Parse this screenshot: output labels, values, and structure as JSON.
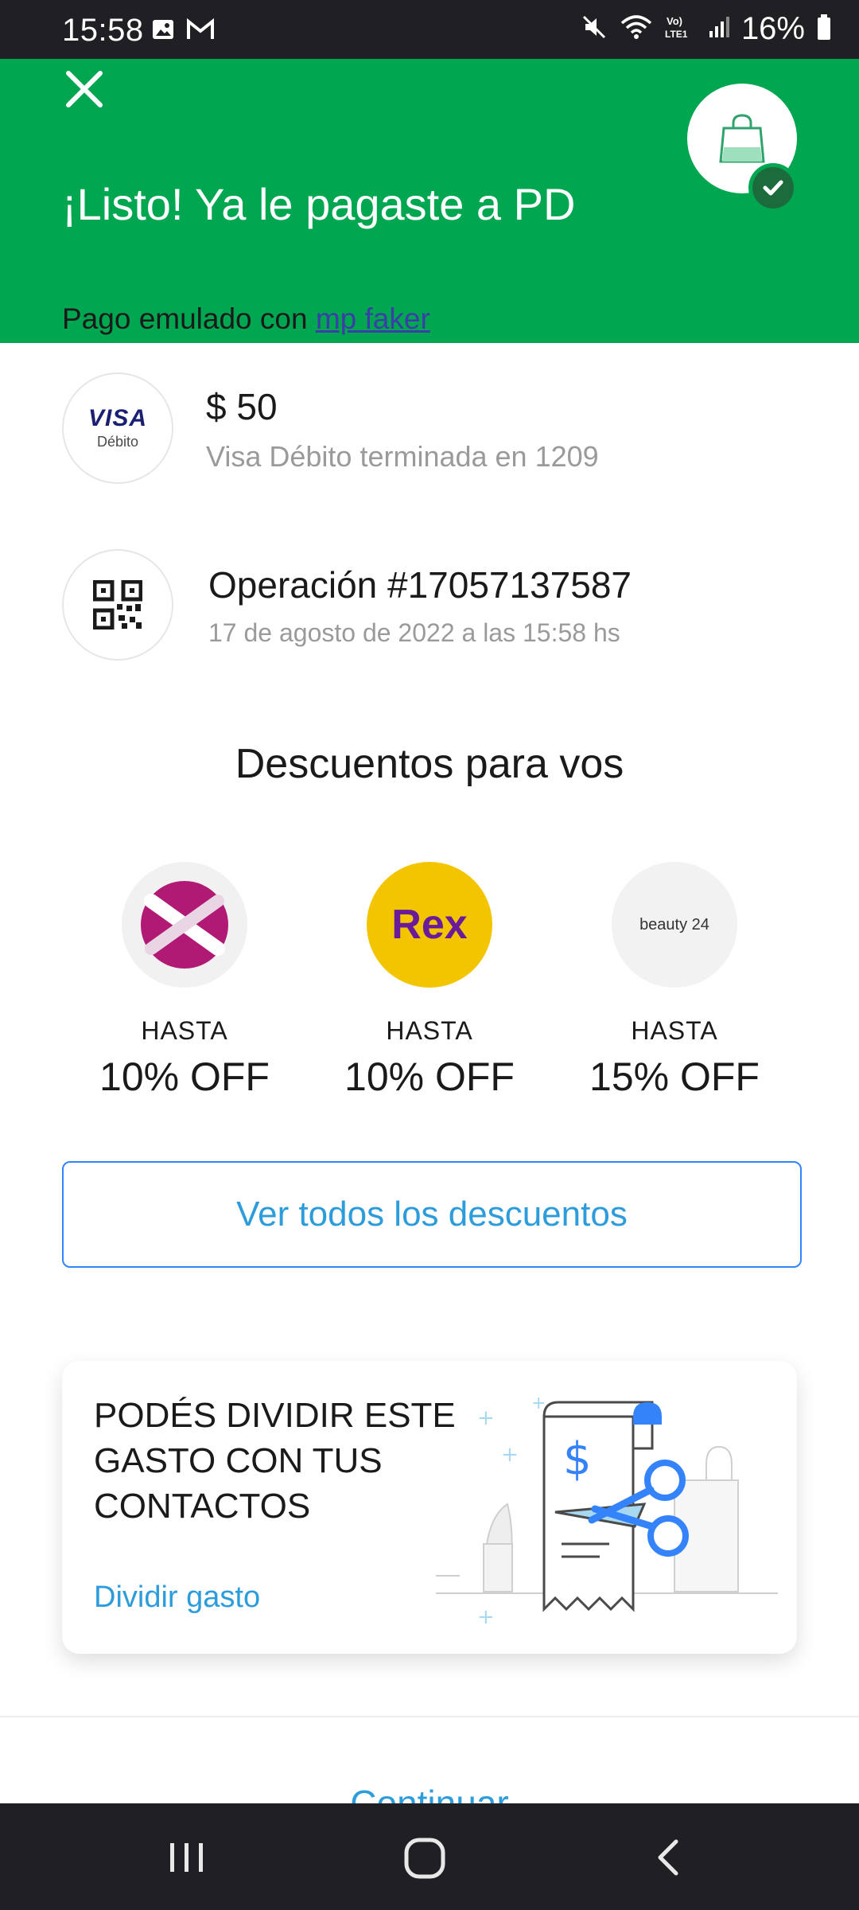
{
  "status_bar": {
    "time": "15:58",
    "battery": "16%",
    "left_icons": [
      "image-icon",
      "gmail-icon"
    ],
    "right_icons": [
      "mute-icon",
      "wifi-icon",
      "volte-icon",
      "signal-icon",
      "battery-icon"
    ],
    "volte_label": "Vo) LTE1"
  },
  "header": {
    "title": "¡Listo! Ya le pagaste a PD",
    "subtitle_prefix": "Pago emulado con ",
    "subtitle_link": "mp faker",
    "bg_color": "#00a650"
  },
  "payment": {
    "card_brand": "VISA",
    "card_type": "Débito",
    "amount": "$ 50",
    "card_description": "Visa Débito terminada en 1209"
  },
  "operation": {
    "number": "Operación #17057137587",
    "date": "17 de agosto de 2022 a las 15:58 hs"
  },
  "discounts": {
    "title": "Descuentos para vos",
    "items": [
      {
        "logo": "x-brand-logo",
        "label": "HASTA",
        "value": "10% OFF"
      },
      {
        "logo": "Rex",
        "label": "HASTA",
        "value": "10% OFF"
      },
      {
        "logo": "beauty 24",
        "label": "HASTA",
        "value": "15% OFF"
      }
    ],
    "view_all": "Ver todos los descuentos"
  },
  "divide": {
    "text": "PODÉS DIVIDIR ESTE GASTO CON TUS CONTACTOS",
    "link": "Dividir gasto"
  },
  "footer": {
    "continue": "Continuar"
  },
  "accent_color": "#2d9cdb"
}
